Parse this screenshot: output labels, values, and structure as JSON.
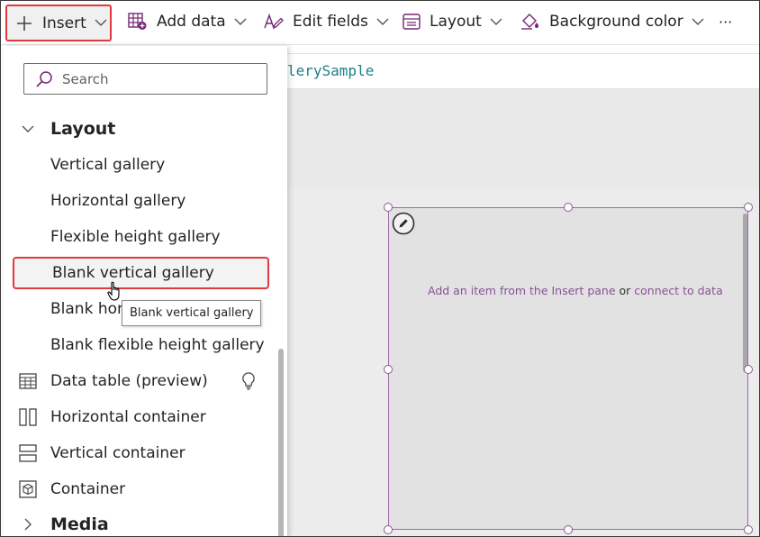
{
  "toolbar": {
    "insert_label": "Insert",
    "add_data_label": "Add data",
    "edit_fields_label": "Edit fields",
    "layout_label": "Layout",
    "background_color_label": "Background color",
    "more_label": "···"
  },
  "formula": {
    "text": "lerySample"
  },
  "insert_pane": {
    "search_placeholder": "Search",
    "sections": {
      "layout": "Layout",
      "media": "Media"
    },
    "items": [
      {
        "label": "Vertical gallery",
        "icon": "gallery-icon"
      },
      {
        "label": "Horizontal gallery",
        "icon": "gallery-icon"
      },
      {
        "label": "Flexible height gallery",
        "icon": "gallery-icon"
      },
      {
        "label": "Blank vertical gallery",
        "icon": "gallery-icon"
      },
      {
        "label": "Blank hori",
        "icon": "gallery-icon"
      },
      {
        "label": "Blank flexible height gallery",
        "icon": "gallery-icon"
      },
      {
        "label": "Data table (preview)",
        "icon": "table-icon"
      },
      {
        "label": "Horizontal container",
        "icon": "horizontal-container-icon"
      },
      {
        "label": "Vertical container",
        "icon": "vertical-container-icon"
      },
      {
        "label": "Container",
        "icon": "container-icon"
      }
    ],
    "tooltip": "Blank vertical gallery"
  },
  "canvas": {
    "message_part1": "Add an item from the Insert pane",
    "message_or": " or ",
    "message_link": "connect to data"
  },
  "colors": {
    "accent_purple": "#742774",
    "highlight_border": "#e0393e",
    "gallery_border": "#9b6aa6",
    "gallery_icon": [
      "#e8b84a",
      "#8ccf6a",
      "#4aa6c8",
      "#f0d878"
    ]
  }
}
